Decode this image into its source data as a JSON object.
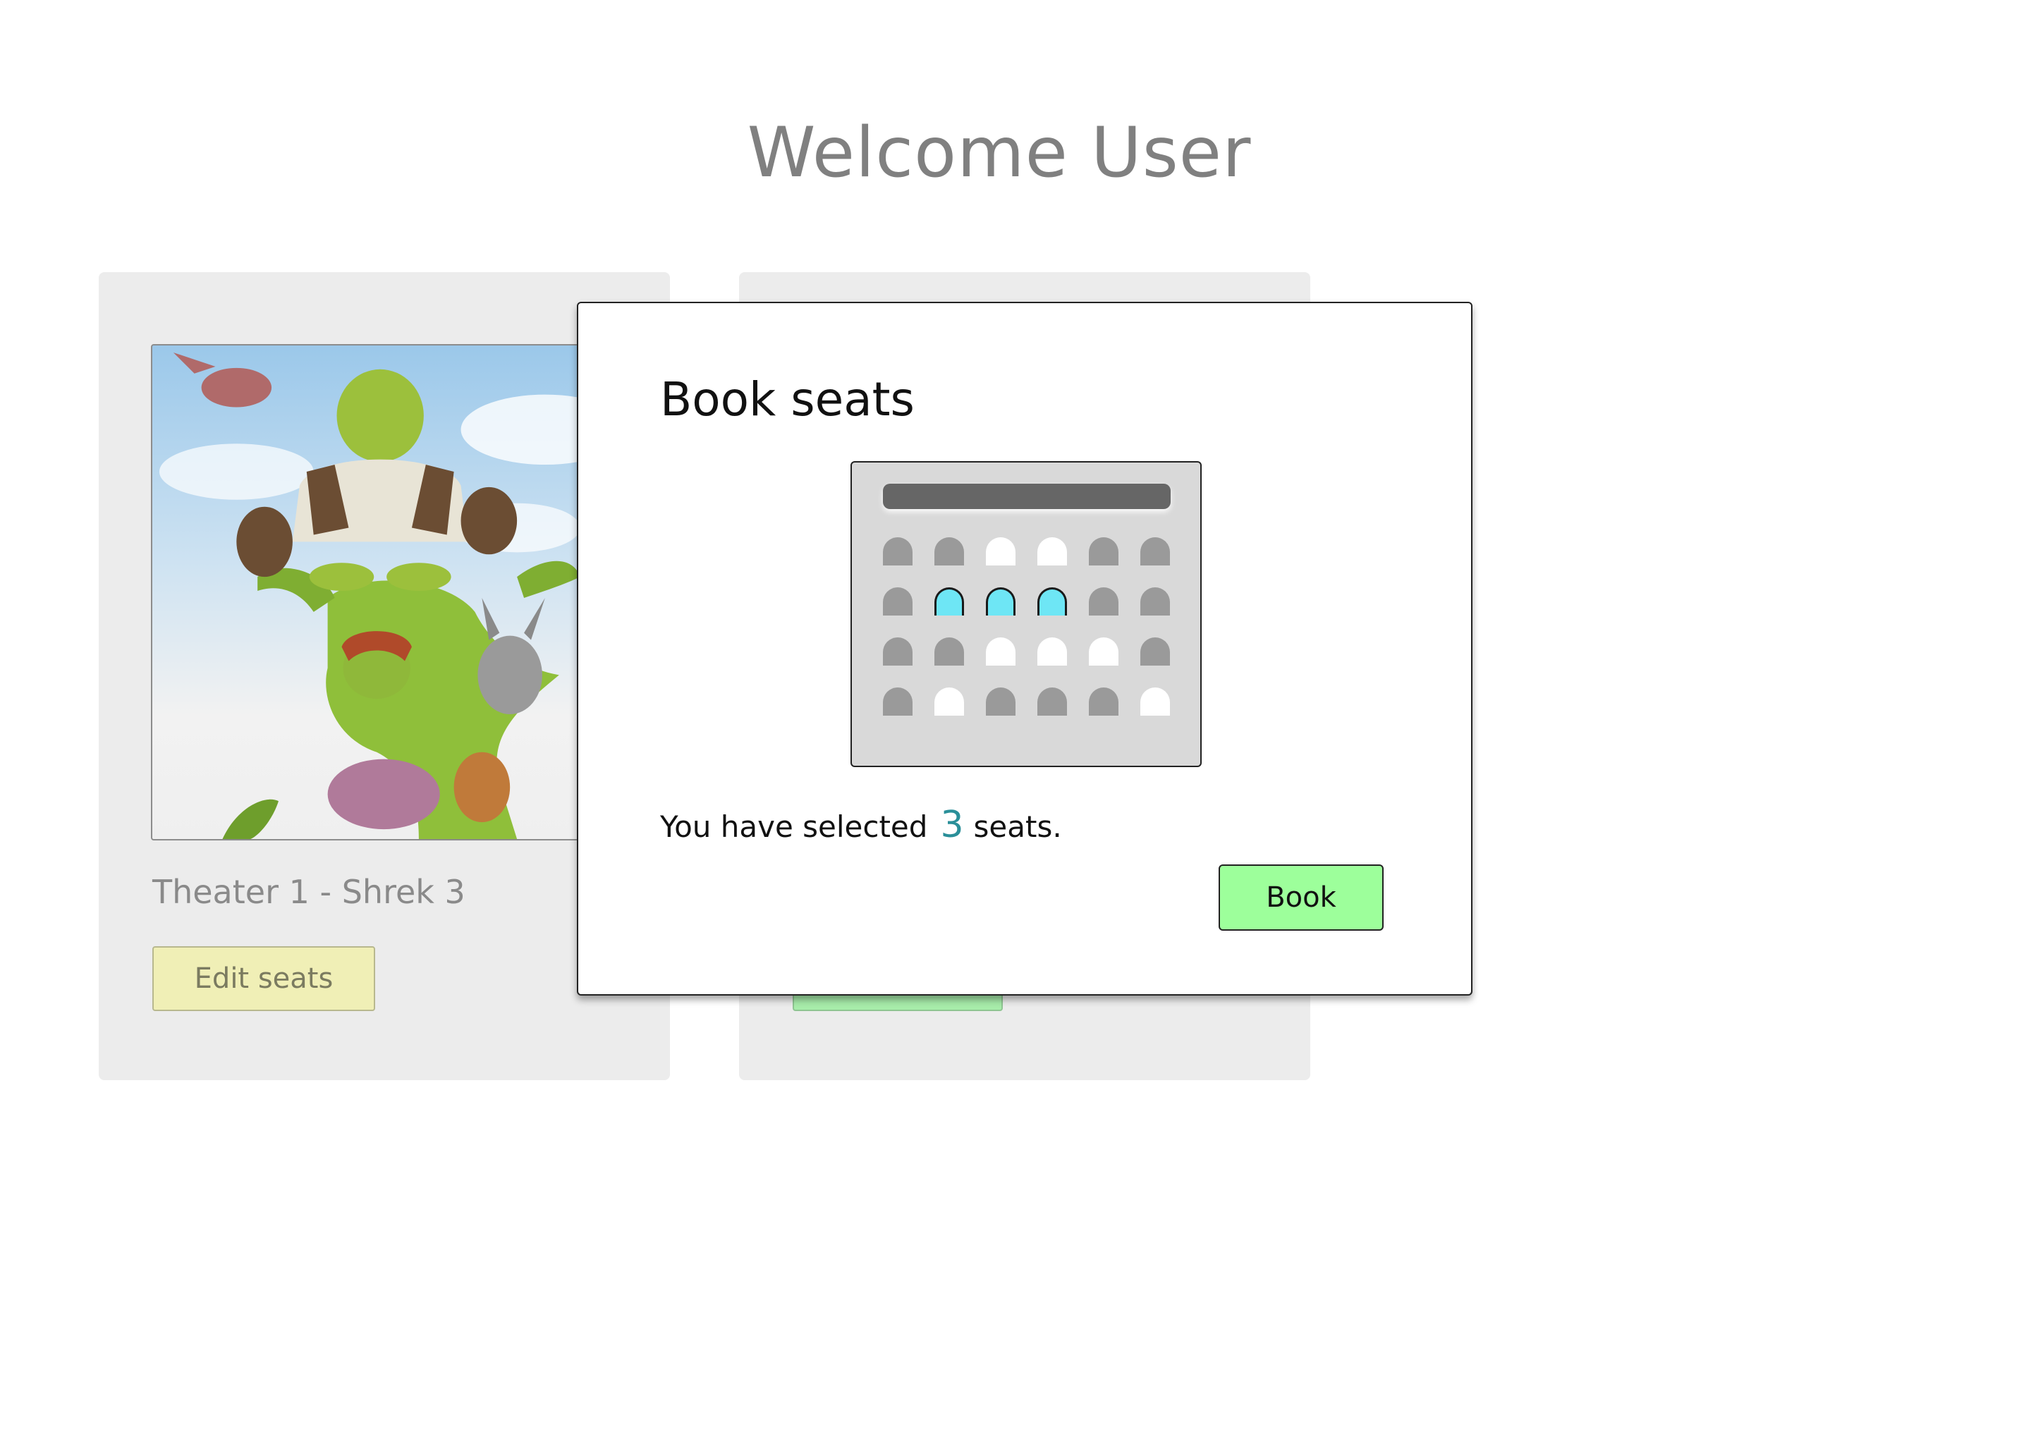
{
  "header": {
    "title": "Welcome User"
  },
  "cards": [
    {
      "title": "Theater 1 - Shrek 3",
      "button_label": "Edit seats",
      "accent": "#f0efb6"
    },
    {
      "title": "",
      "button_label": "",
      "accent": "#a7ecaa"
    }
  ],
  "modal": {
    "title": "Book seats",
    "seat_rows": [
      [
        "taken",
        "taken",
        "free",
        "free",
        "taken",
        "taken"
      ],
      [
        "taken",
        "selected",
        "selected",
        "selected",
        "taken",
        "taken"
      ],
      [
        "taken",
        "taken",
        "free",
        "free",
        "free",
        "taken"
      ],
      [
        "taken",
        "free",
        "taken",
        "taken",
        "taken",
        "free"
      ]
    ],
    "selection_prefix": "You have selected",
    "selected_count": "3",
    "selection_suffix": "seats.",
    "book_label": "Book",
    "colors": {
      "selected_seat": "#6ee6f5",
      "taken_seat": "#9a9a9a",
      "free_seat": "#ffffff",
      "book_button": "#9dff9b"
    }
  }
}
